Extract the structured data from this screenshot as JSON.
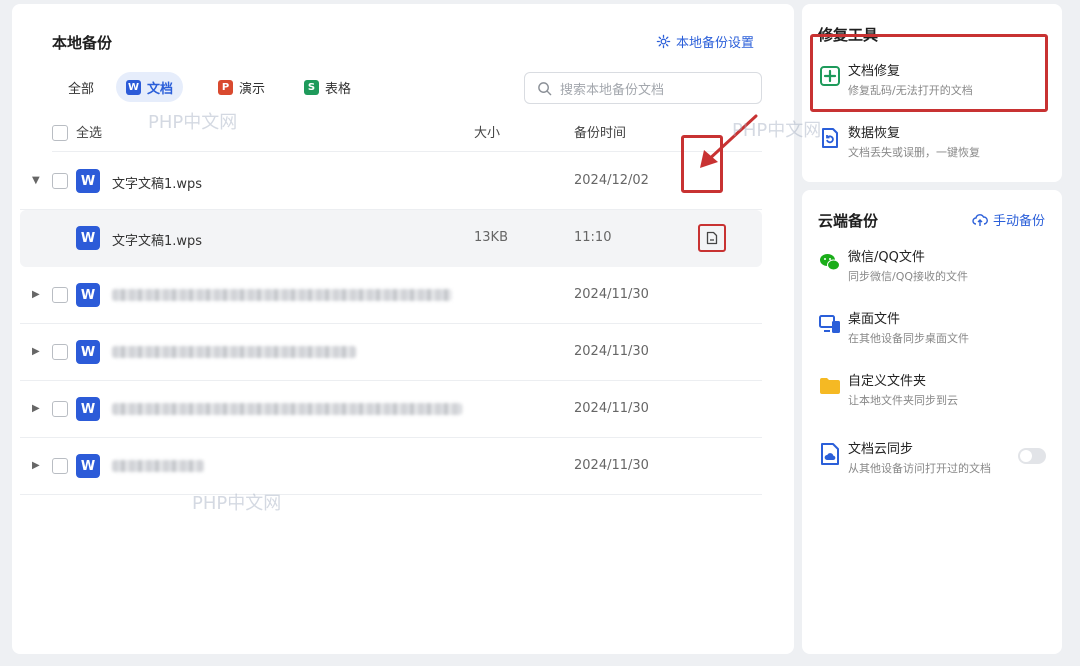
{
  "local_backup": {
    "title": "本地备份",
    "settings_link": "本地备份设置",
    "tabs": [
      {
        "label": "全部",
        "icon": null
      },
      {
        "label": "文档",
        "icon": "W"
      },
      {
        "label": "演示",
        "icon": "P"
      },
      {
        "label": "表格",
        "icon": "S"
      }
    ],
    "active_tab": "文档",
    "search_placeholder": "搜索本地备份文档",
    "columns": {
      "select_all": "全选",
      "size": "大小",
      "backup_time": "备份时间"
    },
    "rows": [
      {
        "name": "文字文稿1.wps",
        "size": "",
        "time": "2024/12/02",
        "expanded": true,
        "blurred": false
      },
      {
        "name": "文字文稿1.wps",
        "size": "13KB",
        "time": "11:10",
        "child": true,
        "blurred": false
      },
      {
        "name": "",
        "size": "",
        "time": "2024/11/30",
        "blurred": true
      },
      {
        "name": "",
        "size": "",
        "time": "2024/11/30",
        "blurred": true
      },
      {
        "name": "",
        "size": "",
        "time": "2024/11/30",
        "blurred": true
      },
      {
        "name": "",
        "size": "",
        "time": "2024/11/30",
        "blurred": true
      }
    ]
  },
  "repair_tools": {
    "title": "修复工具",
    "items": [
      {
        "title": "文档修复",
        "desc": "修复乱码/无法打开的文档",
        "icon": "doc-repair-icon"
      },
      {
        "title": "数据恢复",
        "desc": "文档丢失或误删，一键恢复",
        "icon": "data-recovery-icon"
      }
    ]
  },
  "cloud_backup": {
    "title": "云端备份",
    "manual_link": "手动备份",
    "items": [
      {
        "title": "微信/QQ文件",
        "desc": "同步微信/QQ接收的文件",
        "icon": "wechat-icon"
      },
      {
        "title": "桌面文件",
        "desc": "在其他设备同步桌面文件",
        "icon": "desktop-icon"
      },
      {
        "title": "自定义文件夹",
        "desc": "让本地文件夹同步到云",
        "icon": "folder-icon"
      },
      {
        "title": "文档云同步",
        "desc": "从其他设备访问打开过的文档",
        "icon": "cloud-doc-icon",
        "toggle": false
      }
    ]
  },
  "watermark": "PHP中文网",
  "colors": {
    "accent": "#2b5fd9",
    "annotation": "#c83232",
    "word": "#2c5bd8"
  }
}
